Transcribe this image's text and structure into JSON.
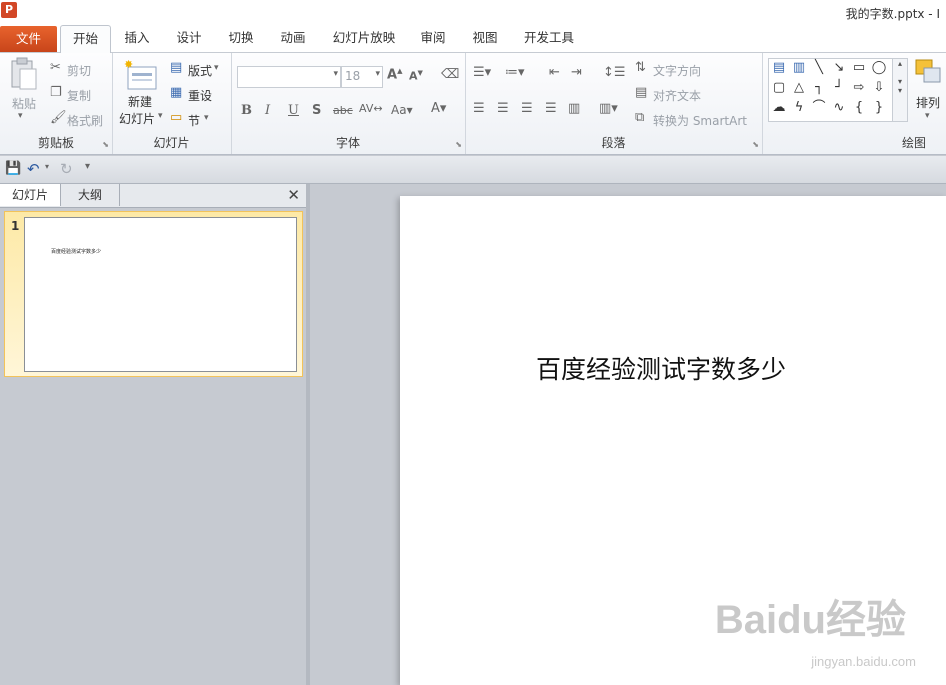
{
  "window": {
    "app_icon": "P",
    "title": "我的字数.pptx - I"
  },
  "tabs": [
    {
      "label": "文件"
    },
    {
      "label": "开始"
    },
    {
      "label": "插入"
    },
    {
      "label": "设计"
    },
    {
      "label": "切换"
    },
    {
      "label": "动画"
    },
    {
      "label": "幻灯片放映"
    },
    {
      "label": "审阅"
    },
    {
      "label": "视图"
    },
    {
      "label": "开发工具"
    }
  ],
  "ribbon": {
    "clipboard": {
      "paste": "粘贴",
      "cut": "剪切",
      "copy": "复制",
      "format_painter": "格式刷",
      "label": "剪贴板"
    },
    "slides": {
      "new_slide_1": "新建",
      "new_slide_2": "幻灯片",
      "layout": "版式",
      "reset": "重设",
      "section": "节",
      "label": "幻灯片"
    },
    "font": {
      "font_name": "",
      "font_size": "18",
      "label": "字体"
    },
    "paragraph": {
      "text_direction": "文字方向",
      "align_text": "对齐文本",
      "convert_smartart": "转换为 SmartArt",
      "label": "段落"
    },
    "drawing": {
      "arrange": "排列",
      "label": "绘图"
    }
  },
  "panel": {
    "tab_slides": "幻灯片",
    "tab_outline": "大纲",
    "slide_number": "1",
    "thumb_text": "百度经验测试字数多少"
  },
  "slide": {
    "text": "百度经验测试字数多少",
    "watermark": "Baidu经验",
    "watermark_url": "jingyan.baidu.com"
  }
}
